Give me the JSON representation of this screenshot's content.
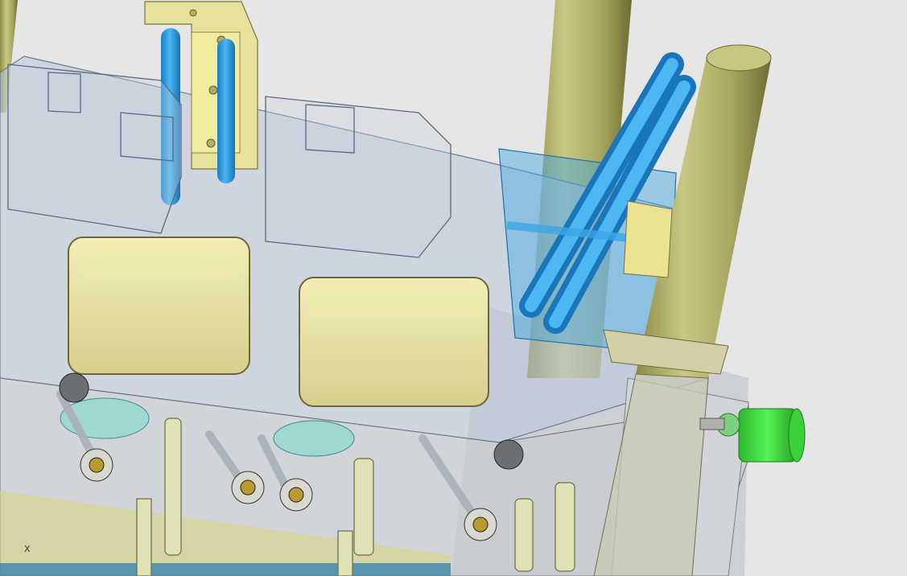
{
  "viewport": {
    "background": "#e6e6e6",
    "axis_triad_label": "X"
  },
  "colors": {
    "guide_pillar": "#b9b870",
    "cooling_channel": "#2a9fe0",
    "transparent_plate": "#bcc8d8",
    "insert_block": "#e8e3a6",
    "ejector_pin": "#d8dca6",
    "green_connector": "#3bdc3b",
    "cyan_bushing": "#9fd7d2"
  },
  "parts": [
    {
      "name": "guide-pillar-left"
    },
    {
      "name": "guide-pillar-right-back"
    },
    {
      "name": "guide-pillar-right-front"
    },
    {
      "name": "top-insert-block"
    },
    {
      "name": "transparent-mold-plate"
    },
    {
      "name": "lower-plate"
    },
    {
      "name": "cavity-insert-left"
    },
    {
      "name": "cavity-insert-right"
    },
    {
      "name": "cooling-block"
    },
    {
      "name": "green-connector"
    }
  ]
}
